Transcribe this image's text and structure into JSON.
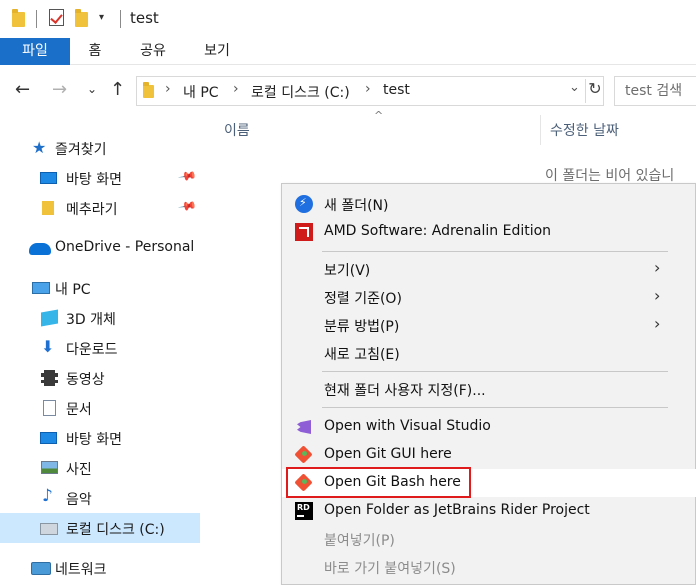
{
  "window": {
    "title": "test"
  },
  "ribbon": {
    "tabs": [
      "파일",
      "홈",
      "공유",
      "보기"
    ]
  },
  "address": {
    "segments": [
      "내 PC",
      "로컬 디스크 (C:)",
      "test"
    ],
    "search_placeholder": "test 검색"
  },
  "nav": {
    "items": [
      {
        "label": "즐겨찾기",
        "icon": "star-icon"
      },
      {
        "label": "바탕 화면",
        "icon": "desktop-icon"
      },
      {
        "label": "메추라기",
        "icon": "folder-icon"
      },
      {
        "label": "OneDrive - Personal",
        "icon": "cloud-icon"
      },
      {
        "label": "내 PC",
        "icon": "computer-icon"
      },
      {
        "label": "3D 개체",
        "icon": "cube-icon"
      },
      {
        "label": "다운로드",
        "icon": "download-icon"
      },
      {
        "label": "동영상",
        "icon": "video-icon"
      },
      {
        "label": "문서",
        "icon": "document-icon"
      },
      {
        "label": "바탕 화면",
        "icon": "desktop-icon"
      },
      {
        "label": "사진",
        "icon": "pictures-icon"
      },
      {
        "label": "음악",
        "icon": "music-icon"
      },
      {
        "label": "로컬 디스크 (C:)",
        "icon": "drive-icon"
      },
      {
        "label": "네트워크",
        "icon": "network-icon"
      }
    ]
  },
  "content": {
    "columns": [
      "이름",
      "수정한 날짜"
    ],
    "empty_message": "이 폴더는 비어 있습니"
  },
  "context_menu": {
    "items": [
      {
        "label": "새 폴더(N)",
        "icon": "new-folder-icon"
      },
      {
        "label": "AMD Software: Adrenalin Edition",
        "icon": "amd-icon"
      },
      {
        "label": "보기(V)",
        "submenu": true
      },
      {
        "label": "정렬 기준(O)",
        "submenu": true
      },
      {
        "label": "분류 방법(P)",
        "submenu": true
      },
      {
        "label": "새로 고침(E)"
      },
      {
        "label": "현재 폴더 사용자 지정(F)..."
      },
      {
        "label": "Open with Visual Studio",
        "icon": "visual-studio-icon"
      },
      {
        "label": "Open Git GUI here",
        "icon": "git-icon"
      },
      {
        "label": "Open Git Bash here",
        "icon": "git-icon",
        "highlighted": true
      },
      {
        "label": "Open Folder as JetBrains Rider Project",
        "icon": "rider-icon"
      },
      {
        "label": "붙여넣기(P)",
        "disabled": true
      },
      {
        "label": "바로 가기 붙여넣기(S)",
        "disabled": true
      }
    ]
  },
  "colors": {
    "accent": "#1a6fc9",
    "highlight_box": "#e01b1b",
    "selected": "#cce8ff"
  }
}
